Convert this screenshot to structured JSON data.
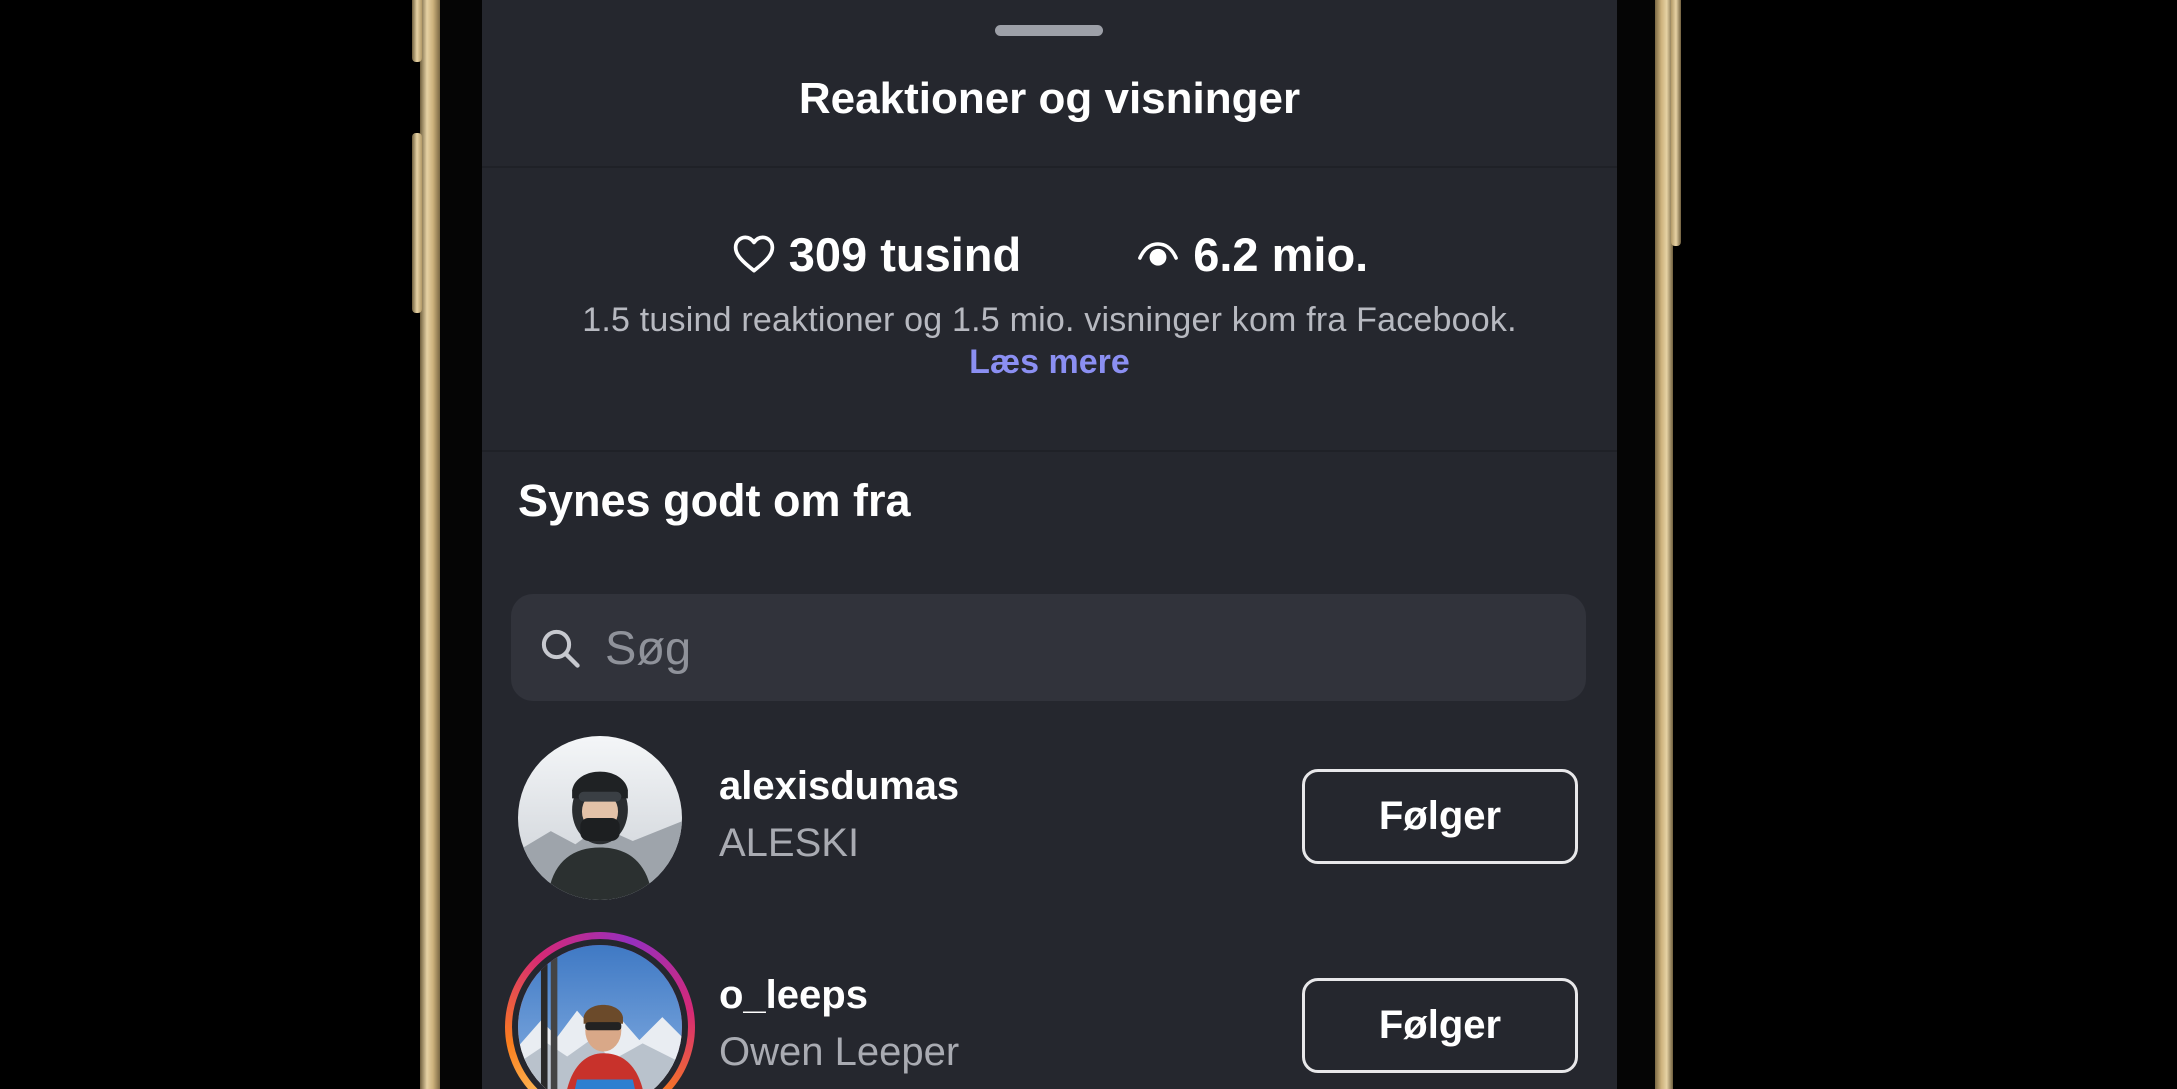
{
  "sheet": {
    "title": "Reaktioner og visninger"
  },
  "stats": {
    "likes_icon": "heart-outline-icon",
    "likes": "309 tusind",
    "views_icon": "eye-icon",
    "views": "6.2 mio."
  },
  "info": {
    "text": "1.5 tusind reaktioner og 1.5 mio. visninger kom fra Facebook.",
    "read_more": "Læs mere",
    "read_more_color": "#8b8ff2"
  },
  "likes_section": {
    "title": "Synes godt om fra",
    "search": {
      "icon": "search-icon",
      "placeholder": "Søg"
    },
    "users": [
      {
        "username": "alexisdumas",
        "full_name": "ALESKI",
        "button": "Følger",
        "has_story_ring": false
      },
      {
        "username": "o_leeps",
        "full_name": "Owen Leeper",
        "button": "Følger",
        "has_story_ring": true
      }
    ]
  },
  "colors": {
    "background": "#25272e",
    "text_primary": "#ffffff",
    "text_secondary": "#a9abb2",
    "search_bg": "#31333b"
  }
}
